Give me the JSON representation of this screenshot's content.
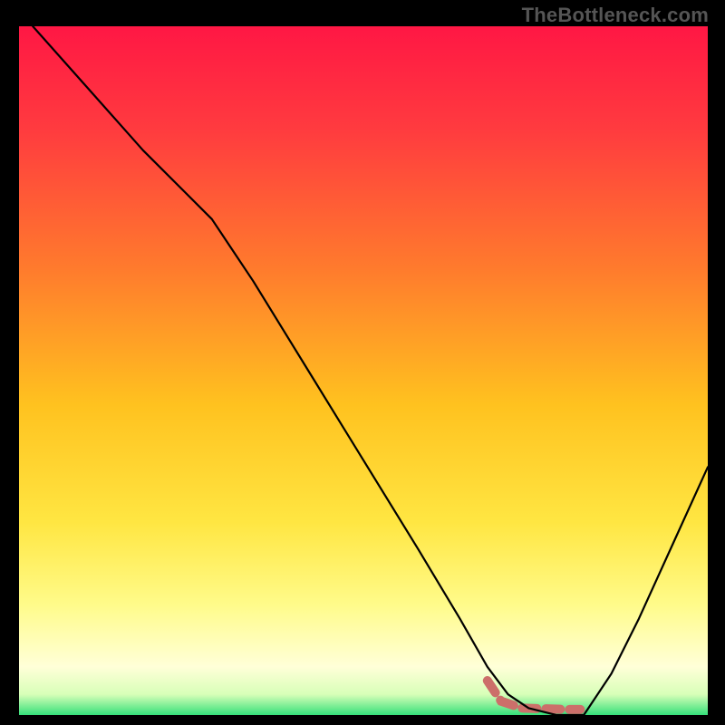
{
  "watermark": "TheBottleneck.com",
  "chart_data": {
    "type": "line",
    "title": "",
    "xlabel": "",
    "ylabel": "",
    "xlim": [
      0,
      100
    ],
    "ylim": [
      0,
      100
    ],
    "gradient": {
      "stops": [
        {
          "offset": 0.0,
          "color": "#ff1744"
        },
        {
          "offset": 0.15,
          "color": "#ff3b3f"
        },
        {
          "offset": 0.35,
          "color": "#ff7a2d"
        },
        {
          "offset": 0.55,
          "color": "#ffc21f"
        },
        {
          "offset": 0.72,
          "color": "#ffe642"
        },
        {
          "offset": 0.84,
          "color": "#fffb8a"
        },
        {
          "offset": 0.93,
          "color": "#ffffd8"
        },
        {
          "offset": 0.97,
          "color": "#d8ffb8"
        },
        {
          "offset": 1.0,
          "color": "#35e07a"
        }
      ]
    },
    "series": [
      {
        "name": "curve",
        "color": "#000000",
        "stroke_width": 2.2,
        "points": [
          {
            "x": 2,
            "y": 100
          },
          {
            "x": 10,
            "y": 91
          },
          {
            "x": 18,
            "y": 82
          },
          {
            "x": 24,
            "y": 76
          },
          {
            "x": 28,
            "y": 72
          },
          {
            "x": 34,
            "y": 63
          },
          {
            "x": 42,
            "y": 50
          },
          {
            "x": 50,
            "y": 37
          },
          {
            "x": 58,
            "y": 24
          },
          {
            "x": 64,
            "y": 14
          },
          {
            "x": 68,
            "y": 7
          },
          {
            "x": 71,
            "y": 3
          },
          {
            "x": 74,
            "y": 1
          },
          {
            "x": 78,
            "y": 0
          },
          {
            "x": 82,
            "y": 0
          },
          {
            "x": 86,
            "y": 6
          },
          {
            "x": 90,
            "y": 14
          },
          {
            "x": 95,
            "y": 25
          },
          {
            "x": 100,
            "y": 36
          }
        ]
      }
    ],
    "marker": {
      "name": "highlight-dash",
      "color": "#cc6f6a",
      "stroke_width": 10,
      "dash": "16 10",
      "points": [
        {
          "x": 68,
          "y": 5
        },
        {
          "x": 70,
          "y": 2
        },
        {
          "x": 73,
          "y": 1
        },
        {
          "x": 80,
          "y": 0.8
        },
        {
          "x": 81.5,
          "y": 0.8
        }
      ]
    }
  }
}
